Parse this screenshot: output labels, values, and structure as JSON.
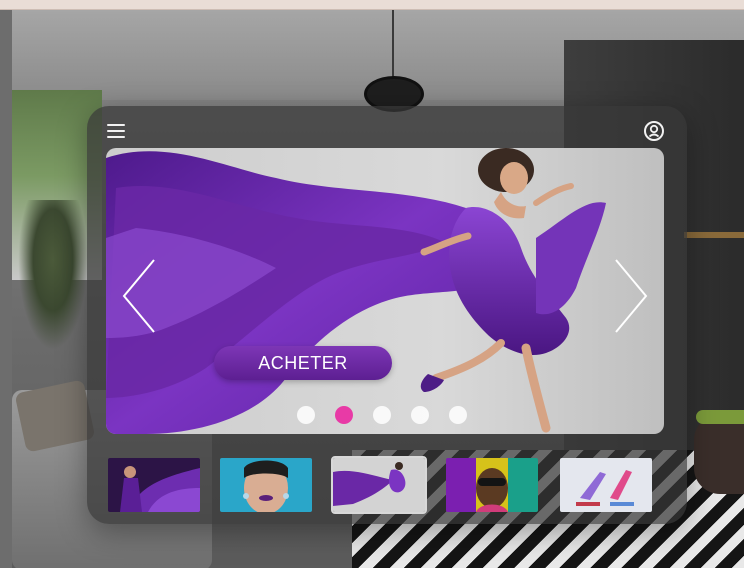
{
  "hero": {
    "buy_label": "ACHETER",
    "slides_total": 5,
    "active_slide": 2
  },
  "colors": {
    "accent_purple": "#6a28a6",
    "dot_active": "#e83aa6",
    "panel_glass": "#373737"
  },
  "icons": {
    "menu": "hamburger-menu-icon",
    "profile": "user-profile-icon",
    "prev": "chevron-left-icon",
    "next": "chevron-right-icon"
  },
  "thumbnails": [
    {
      "name": "thumb-purple-gown",
      "selected": false
    },
    {
      "name": "thumb-purple-lipstick-portrait",
      "selected": false
    },
    {
      "name": "thumb-purple-dress-jump",
      "selected": true
    },
    {
      "name": "thumb-colorful-sunglasses-man",
      "selected": false
    },
    {
      "name": "thumb-high-heel-shoes",
      "selected": false
    }
  ]
}
